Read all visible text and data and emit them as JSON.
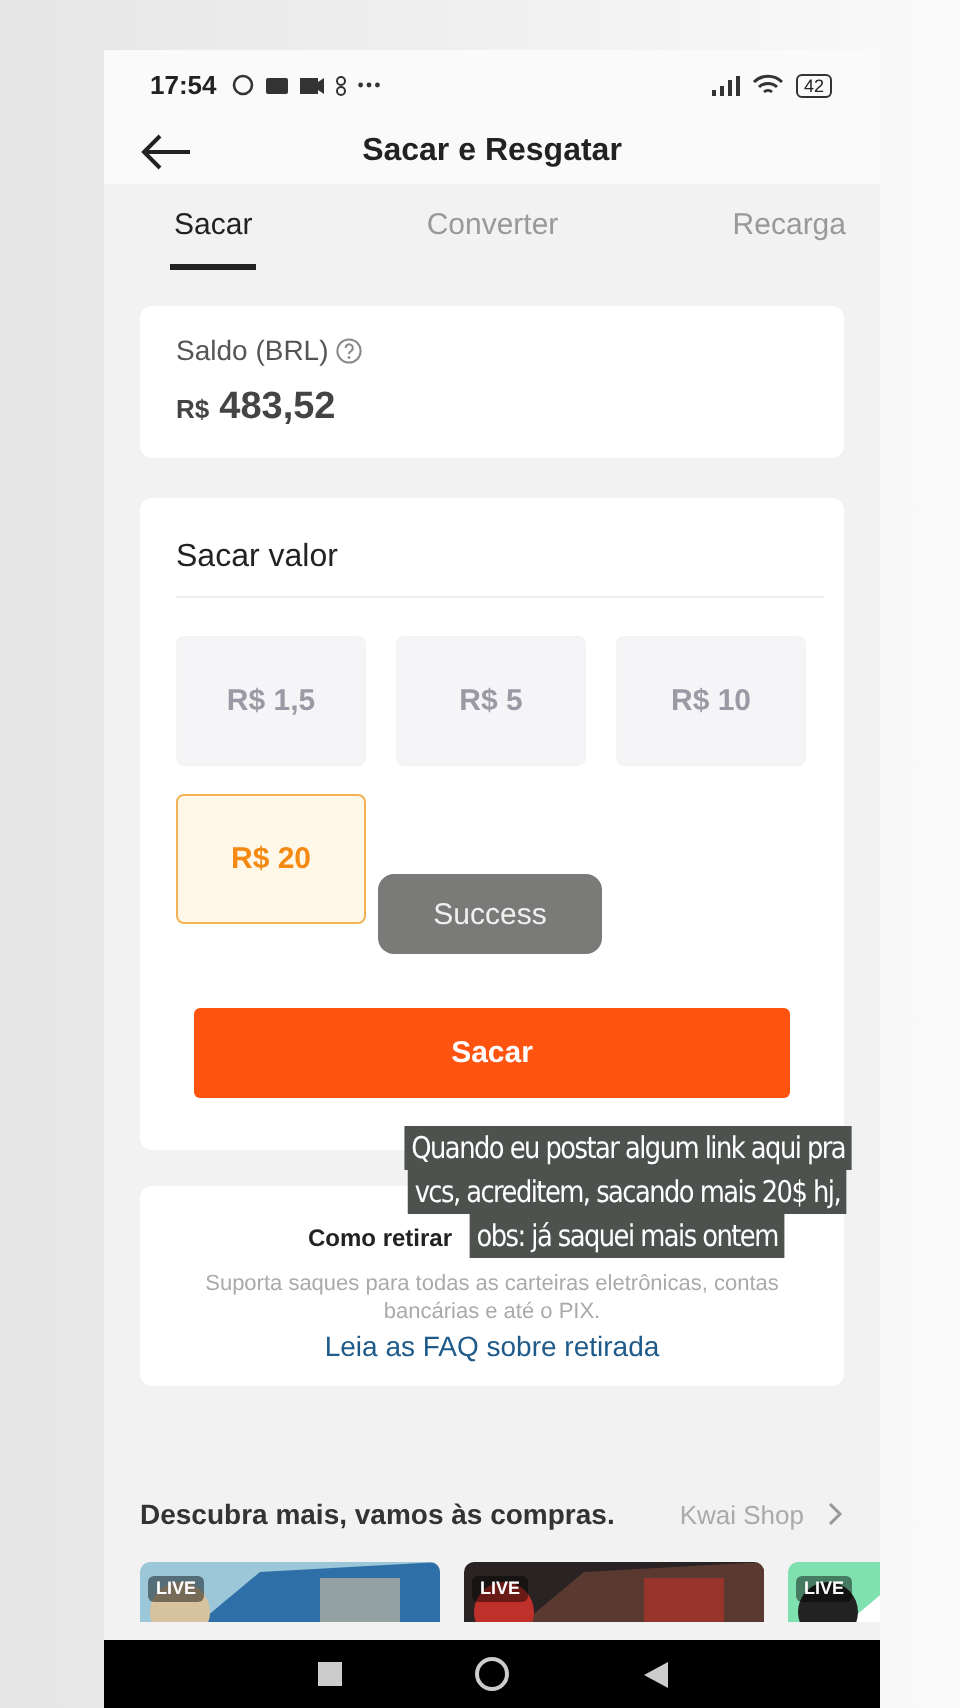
{
  "status_bar": {
    "time": "17:54",
    "battery": "42"
  },
  "header": {
    "title": "Sacar e Resgatar"
  },
  "tabs": [
    {
      "label": "Sacar",
      "selected": true
    },
    {
      "label": "Converter",
      "selected": false
    },
    {
      "label": "Recarga",
      "selected": false
    }
  ],
  "balance": {
    "label": "Saldo (BRL)",
    "currency": "R$",
    "amount": "483,52"
  },
  "withdraw": {
    "title": "Sacar valor",
    "options": [
      {
        "label": "R$ 1,5",
        "selected": false
      },
      {
        "label": "R$ 5",
        "selected": false
      },
      {
        "label": "R$ 10",
        "selected": false
      },
      {
        "label": "R$ 20",
        "selected": true
      }
    ],
    "button": "Sacar"
  },
  "toast": "Success",
  "info": {
    "title": "Como retirar",
    "text": "Suporta saques para todas as carteiras eletrônicas, contas bancárias e até o PIX.",
    "link": "Leia as FAQ sobre retirada"
  },
  "caption": [
    "Quando eu postar algum link aqui pra",
    "vcs, acreditem, sacando mais 20$ hj,",
    "obs: já saquei mais ontem"
  ],
  "discover": {
    "title": "Descubra mais, vamos às compras.",
    "link": "Kwai Shop",
    "cards": [
      {
        "badge": "LIVE"
      },
      {
        "badge": "LIVE"
      },
      {
        "badge": "LIVE"
      }
    ]
  }
}
